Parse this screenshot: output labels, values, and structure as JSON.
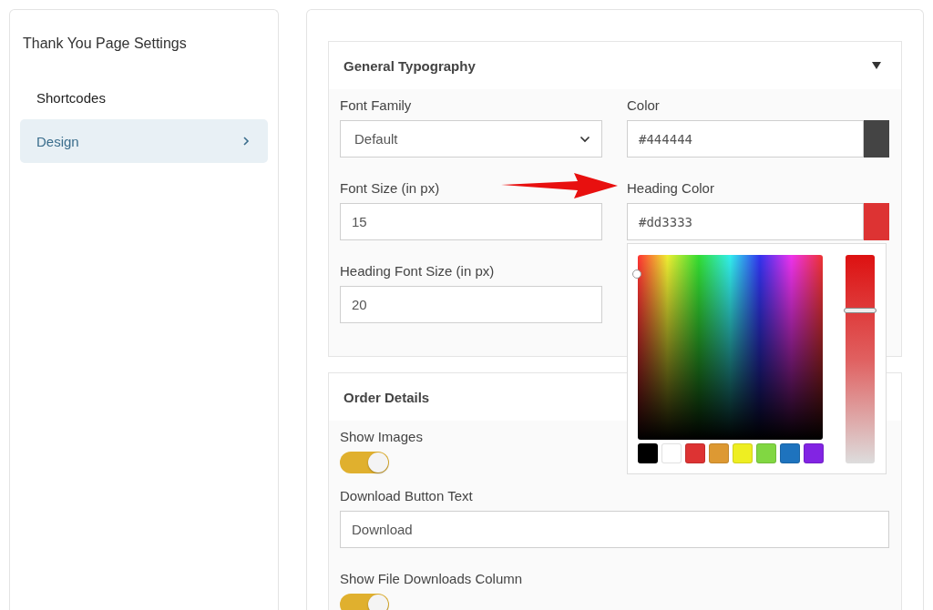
{
  "sidebar": {
    "title": "Thank You Page Settings",
    "items": [
      {
        "label": "Shortcodes",
        "selected": false
      },
      {
        "label": "Design",
        "selected": true
      }
    ]
  },
  "sections": [
    {
      "title": "General Typography",
      "expanded": true,
      "fields": [
        {
          "kind": "select",
          "label": "Font Family",
          "value": "Default"
        },
        {
          "kind": "color",
          "label": "Color",
          "value": "#444444",
          "color": "#444444"
        },
        {
          "kind": "text",
          "label": "Font Size (in px)",
          "value": "15"
        },
        {
          "kind": "color",
          "label": "Heading Color",
          "value": "#dd3333",
          "color": "#dd3333"
        },
        {
          "kind": "text",
          "label": "Heading Font Size (in px)",
          "value": "20"
        }
      ]
    },
    {
      "title": "Order Details",
      "fields": [
        {
          "kind": "toggle",
          "label": "Show Images",
          "on": true
        },
        {
          "kind": "text",
          "label": "Download Button Text",
          "value": "Download"
        },
        {
          "kind": "toggle",
          "label": "Show File Downloads Column",
          "on": true
        }
      ]
    }
  ],
  "color_picker": {
    "level": 0.74,
    "swatches": [
      {
        "color": "#000000"
      },
      {
        "color": "#ffffff"
      },
      {
        "color": "#dd3333"
      },
      {
        "color": "#dd9933"
      },
      {
        "color": "#eeee22"
      },
      {
        "color": "#81d742"
      },
      {
        "color": "#1e73be"
      },
      {
        "color": "#8224e3"
      }
    ]
  }
}
